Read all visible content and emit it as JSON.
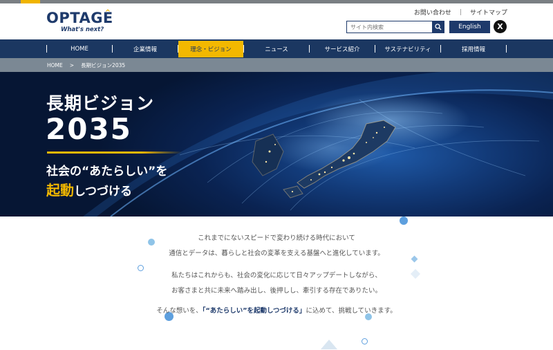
{
  "logo": {
    "main": "OPTAGE",
    "accent": "^",
    "tagline": "What's next?"
  },
  "utility": {
    "contact": "お問い合わせ",
    "separator": "|",
    "sitemap": "サイトマップ"
  },
  "search": {
    "placeholder": "サイト内検索",
    "icon": "search-icon"
  },
  "language": {
    "english": "English"
  },
  "social": {
    "x": "X"
  },
  "nav": {
    "items": [
      {
        "label": "HOME"
      },
      {
        "label": "企業情報"
      },
      {
        "label": "理念・ビジョン"
      },
      {
        "label": "ニュース"
      },
      {
        "label": "サービス紹介"
      },
      {
        "label": "サステナビリティ"
      },
      {
        "label": "採用情報"
      }
    ],
    "active_index": 2
  },
  "breadcrumb": {
    "home": "HOME",
    "sep": ">",
    "current": "長期ビジョン2035"
  },
  "hero": {
    "title": "長期ビジョン",
    "year": "2035",
    "sub1": "社会の“あたらしい”を",
    "sub2_highlight": "起動",
    "sub2_rest": "しつづける"
  },
  "message": {
    "p1_l1": "これまでにないスピードで変わり続ける時代において",
    "p1_l2": "通信とデータは、暮らしと社会の変革を支える基盤へと進化しています。",
    "p2_l1": "私たちはこれからも、社会の変化に応じて日々アップデートしながら、",
    "p2_l2": "お客さまと共に未来へ踏み出し、後押しし、牽引する存在でありたい。",
    "p3_pre": "そんな想いを、",
    "p3_bold": "「“あたらしい”を起動しつづける」",
    "p3_post": "に込めて、挑戦していきます。"
  },
  "colors": {
    "navy": "#1b3761",
    "accent": "#f3b800",
    "breadcrumb": "#7b8894"
  }
}
